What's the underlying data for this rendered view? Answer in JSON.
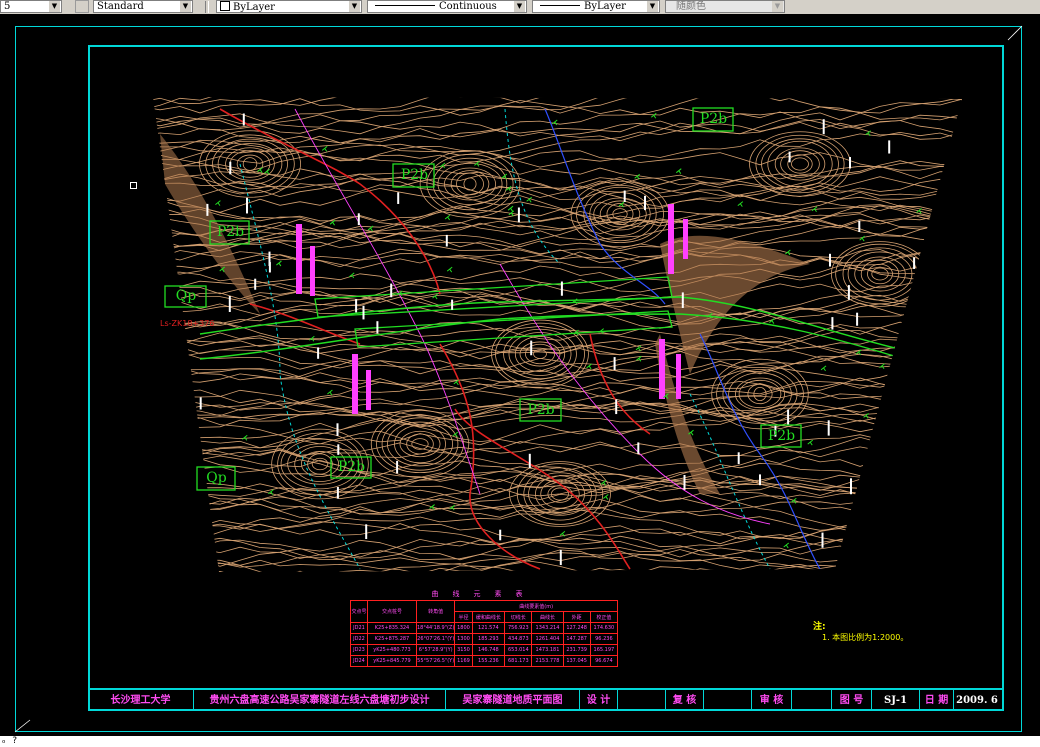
{
  "toolbar": {
    "layer_partial": "5",
    "textstyle": "Standard",
    "color": "ByLayer",
    "linetype": "Continuous",
    "lineweight": "ByLayer",
    "plotstyle": "随颜色"
  },
  "map_labels": {
    "p2b_1": "P2b",
    "p2b_2": "P2b",
    "p2b_3": "P2b",
    "p2b_4": "P2b",
    "p2b_5": "P2b",
    "p2b_6": "P2b",
    "qp_1": "Qp",
    "qp_2": "Qp",
    "station_label": "Ls-ZK18+376"
  },
  "curve_table": {
    "title": "曲线元素表",
    "headers": {
      "col1": "交点号",
      "col2": "交点桩号",
      "col3": "转角值",
      "group": "曲线要素值(m)",
      "sub": [
        "半径",
        "缓和曲线长",
        "切线长",
        "曲线长",
        "外距",
        "校正值"
      ]
    },
    "rows": [
      [
        "JD21",
        "K25+835.324",
        "18°44'18.9\"(Z)",
        "1800",
        "121.574",
        "756.923",
        "1343.214",
        "127.248",
        "174.630"
      ],
      [
        "JD22",
        "K25+875.287",
        "26°07'26.1\"(Y)",
        "1300",
        "185.293",
        "434.873",
        "1261.404",
        "147.287",
        "96.236"
      ],
      [
        "JD23",
        "yK25+480.773",
        "6°57'28.9\"(Y)",
        "3150",
        "146.748",
        "653.014",
        "1473.181",
        "231.739",
        "165.197"
      ],
      [
        "JD24",
        "yK25+845.779",
        "55°57'26.5\"(Y)",
        "1169",
        "155.236",
        "681.173",
        "2153.778",
        "137.045",
        "96.674"
      ]
    ]
  },
  "notes": {
    "heading": "注:",
    "line1": "1. 本图比例为1:2000。"
  },
  "title_block": {
    "university": "长沙理工大学",
    "project": "贵州六盘高速公路吴家寨隧道左线六盘塘初步设计",
    "drawing_name": "吴家寨隧道地质平面图",
    "design_label": "设 计",
    "check_label": "复 核",
    "review_label": "审 核",
    "figno_label": "图 号",
    "figno_value": "SJ-1",
    "date_label": "日 期",
    "date_value": "2009. 6"
  },
  "command_line": {
    "text": "ₒ ?"
  }
}
